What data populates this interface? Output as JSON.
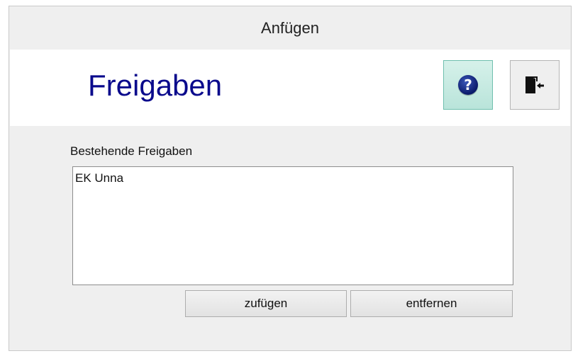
{
  "window": {
    "title": "Anfügen"
  },
  "header": {
    "heading": "Freigaben",
    "help_icon": "help-icon",
    "exit_icon": "door-exit-icon"
  },
  "main": {
    "list_label": "Bestehende Freigaben",
    "items": [
      {
        "label": "EK Unna"
      }
    ],
    "add_button": "zufügen",
    "remove_button": "entfernen"
  },
  "colors": {
    "heading": "#0a0a8c",
    "help_button_bg": "#c8ebe2",
    "window_bg": "#efefef"
  }
}
